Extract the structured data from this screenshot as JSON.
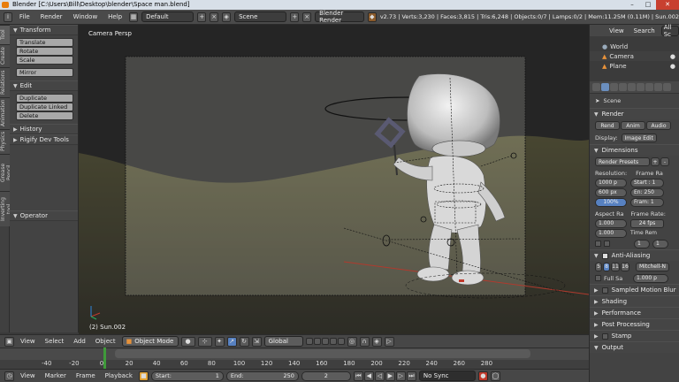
{
  "window": {
    "title": "Blender  [C:\\Users\\Bill\\Desktop\\blender\\Space man.blend]"
  },
  "info": {
    "menu": [
      "File",
      "Render",
      "Window",
      "Help"
    ],
    "layout": "Default",
    "scene": "Scene",
    "engine": "Blender Render",
    "stats": "v2.73 | Verts:3,230 | Faces:3,815 | Tris:6,248 | Objects:0/7 | Lamps:0/2 | Mem:11.25M (0.11M) | Sun.002"
  },
  "toolshelf": {
    "tabs": [
      "Tool",
      "Create",
      "Relations",
      "Animation",
      "Physics",
      "Grease Pencil",
      "Inverting tool"
    ],
    "transform": {
      "title": "Transform",
      "buttons": [
        "Translate",
        "Rotate",
        "Scale"
      ],
      "mirror": "Mirror"
    },
    "edit": {
      "title": "Edit",
      "buttons": [
        "Duplicate",
        "Duplicate Linked",
        "Delete"
      ]
    },
    "history": "History",
    "rigify": "Rigify Dev Tools",
    "operator": "Operator"
  },
  "viewport": {
    "label": "Camera Persp",
    "object_label": "(2) Sun.002"
  },
  "view3d_header": {
    "menu": [
      "View",
      "Select",
      "Add",
      "Object"
    ],
    "mode": "Object Mode",
    "orientation": "Global"
  },
  "timeline": {
    "ticks": [
      -40,
      -20,
      0,
      20,
      40,
      60,
      80,
      100,
      120,
      140,
      160,
      180,
      200,
      220,
      240,
      260,
      280
    ],
    "current_frame": 2,
    "menu": [
      "View",
      "Marker",
      "Frame",
      "Playback"
    ],
    "start": {
      "label": "Start:",
      "value": "1"
    },
    "end": {
      "label": "End:",
      "value": "250"
    },
    "frame_value": "2",
    "sync": "No Sync"
  },
  "outliner": {
    "menu": [
      "View",
      "Search"
    ],
    "filter": "All Sc",
    "rows": [
      "World",
      "Camera",
      "Plane"
    ]
  },
  "properties": {
    "context": "Scene",
    "render": {
      "title": "Render",
      "buttons": [
        "Rend",
        "Anim",
        "Audio"
      ],
      "display_label": "Display:",
      "display_value": "Image Edit"
    },
    "dimensions": {
      "title": "Dimensions",
      "presets": "Render Presets",
      "resolution_label": "Resolution:",
      "frame_range_label": "Frame Ra",
      "res_x": "1000 p",
      "res_y": "600 px",
      "res_pct": "100%",
      "start": "Start : 1",
      "end": "En: 250",
      "frame": "Fram: 1",
      "aspect_label": "Aspect Ra",
      "frame_rate_label": "Frame Rate:",
      "aspect_x": "1.000",
      "aspect_y": "1.000",
      "fps": "24 fps",
      "time_remap": "Time Rem",
      "remap_old": "1",
      "remap_new": "1"
    },
    "antialiasing": {
      "title": "Anti-Aliasing",
      "samples": [
        "5",
        "8",
        "11",
        "16"
      ],
      "filter": "Mitchell-N",
      "full_sample": "Full Sa",
      "size": "1.000 p"
    },
    "collapsed": [
      "Sampled Motion Blur",
      "Shading",
      "Performance",
      "Post Processing",
      "Stamp",
      "Output"
    ]
  },
  "colors": {
    "accent": "#5781c1",
    "playhead": "#3f9a3a",
    "ground": "#707050"
  }
}
